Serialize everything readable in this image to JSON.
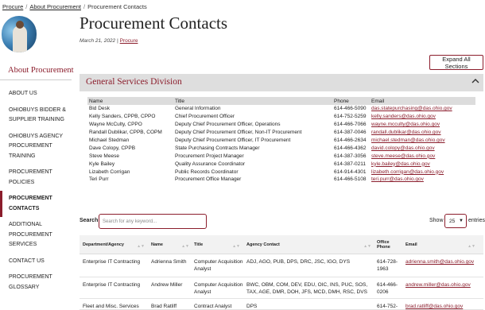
{
  "breadcrumb": {
    "items": [
      "Procure",
      "About Procurement",
      "Procurement Contacts"
    ],
    "sep": "/"
  },
  "page": {
    "title": "Procurement Contacts",
    "date": "March 21, 2022 |",
    "date_link": "Procure"
  },
  "sidebar": {
    "title": "About Procurement",
    "items": [
      {
        "label": "ABOUT US"
      },
      {
        "label": "OHIOBUYS BIDDER & SUPPLIER TRAINING"
      },
      {
        "label": "OHIOBUYS AGENCY PROCUREMENT TRAINING"
      },
      {
        "label": "PROCUREMENT POLICIES"
      },
      {
        "label": "PROCUREMENT CONTACTS"
      },
      {
        "label": "ADDITIONAL PROCUREMENT SERVICES"
      },
      {
        "label": "CONTACT US"
      },
      {
        "label": "PROCUREMENT GLOSSARY"
      }
    ]
  },
  "expand_all_label": "Expand All Sections",
  "gsd": {
    "title": "General Services Division",
    "headers": [
      "Name",
      "Title",
      "Phone",
      "Email"
    ],
    "rows": [
      [
        "Bid Desk",
        "General Information",
        "614-466-5090",
        "das.statepurchasing@das.ohio.gov"
      ],
      [
        "Kelly Sanders, CPPB, CPPO",
        "Chief Procurement Officer",
        "614-752-5259",
        "kelly.sanders@das.ohio.gov"
      ],
      [
        "Wayne McCulty, CPPO",
        "Deputy Chief Procurement Officer, Operations",
        "614-466-7066",
        "wayne.mcculty@das.ohio.gov"
      ],
      [
        "Randall Dublikar, CPPB, COPM",
        "Deputy Chief Procurement Officer, Non-IT Procurement",
        "614-387-0046",
        "randall.dublikar@das.ohio.gov"
      ],
      [
        "Michael Stedman",
        "Deputy Chief Procurement Officer, IT Procurement",
        "614-466-2634",
        "michael.stedman@das.ohio.gov"
      ],
      [
        "Dave Colopy, CPPB",
        "State Purchasing Contracts Manager",
        "614-466-4362",
        "david.colopy@das.ohio.gov"
      ],
      [
        "Steve Meese",
        "Procurement Project Manager",
        "614-387-3056",
        "steve.meese@das.ohio.gov"
      ],
      [
        "Kyle Bailey",
        "Quality Assurance Coordinator",
        "614-387-0211",
        "kyle.bailey@das.ohio.gov"
      ],
      [
        "Lizabeth Corrigan",
        "Public Records Coordinator",
        "614-914-4301",
        "lizabeth.corrigan@das.ohio.gov"
      ],
      [
        "Teri Purr",
        "Procurement Office Manager",
        "614-466-5108",
        "teri.purr@das.ohio.gov"
      ]
    ]
  },
  "search": {
    "label": "Search:",
    "placeholder": "Search for any keyword..."
  },
  "length": {
    "show": "Show",
    "value": "25",
    "entries": "entries"
  },
  "table": {
    "headers": [
      "Department/Agency",
      "Name",
      "Title",
      "Agency Contact",
      "Office Phone",
      "Email"
    ],
    "rows": [
      [
        "Enterprise IT Contracting",
        "Adrienna Smith",
        "Computer Acquisition Analyst",
        "ADJ, AGO, PUB, DPS, DRC, JSC, IGO, DYS",
        "614-728-1963",
        "adrienna.smith@das.ohio.gov"
      ],
      [
        "Enterprise IT Contracting",
        "Andrew Miller",
        "Computer Acquisition Analyst",
        "BWC, OBM, COM, DEV, EDU, OIC, INS, PUC, SOS, TAX, AGE, DMR, DOH, JFS, MCD, DMH, RSC, DVS",
        "614-466-0206",
        "andrew.miller@das.ohio.gov"
      ],
      [
        "Fleet and Misc. Services",
        "Brad Ratliff",
        "Contract Analyst",
        "DPS",
        "614-752-",
        "brad.ratliff@das.ohio.gov"
      ]
    ]
  }
}
